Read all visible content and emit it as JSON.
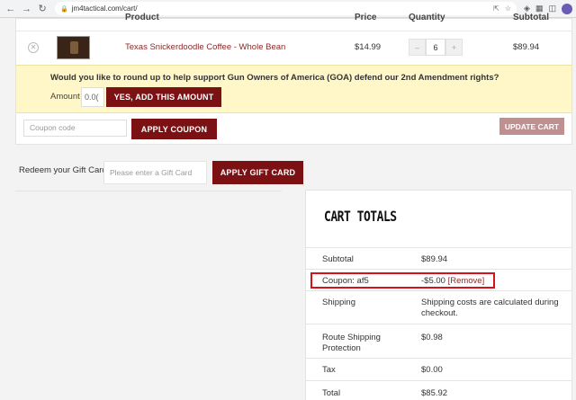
{
  "browser": {
    "url": "jm4tactical.com/cart/"
  },
  "table": {
    "headers": {
      "product": "Product",
      "price": "Price",
      "quantity": "Quantity",
      "subtotal": "Subtotal"
    },
    "item": {
      "name": "Texas Snickerdoodle Coffee - Whole Bean",
      "price": "$14.99",
      "quantity": "6",
      "subtotal": "$89.94"
    }
  },
  "roundup": {
    "question": "Would you like to round up to help support Gun Owners of America (GOA) defend our 2nd Amendment rights?",
    "amount_label": "Amount",
    "amount_value": "0.0(",
    "button": "YES, ADD THIS AMOUNT"
  },
  "coupon": {
    "placeholder": "Coupon code",
    "apply_button": "APPLY COUPON",
    "update_button": "UPDATE CART"
  },
  "gift": {
    "label": "Redeem your Gift Card",
    "placeholder": "Please enter a Gift Card",
    "button": "APPLY GIFT CARD"
  },
  "totals": {
    "title": "CART TOTALS",
    "rows": [
      {
        "label": "Subtotal",
        "value": "$89.94"
      },
      {
        "label": "Coupon: af5",
        "value": "-$5.00",
        "link": "[Remove]"
      },
      {
        "label": "Shipping",
        "value": "Shipping costs are calculated during checkout."
      },
      {
        "label": "Route Shipping Protection",
        "value": "$0.98"
      },
      {
        "label": "Tax",
        "value": "$0.00"
      },
      {
        "label": "Total",
        "value": "$85.92"
      }
    ]
  },
  "colors": {
    "accent": "#7b1113",
    "highlight": "#d6111b",
    "roundup_bg": "#fff7c7"
  }
}
